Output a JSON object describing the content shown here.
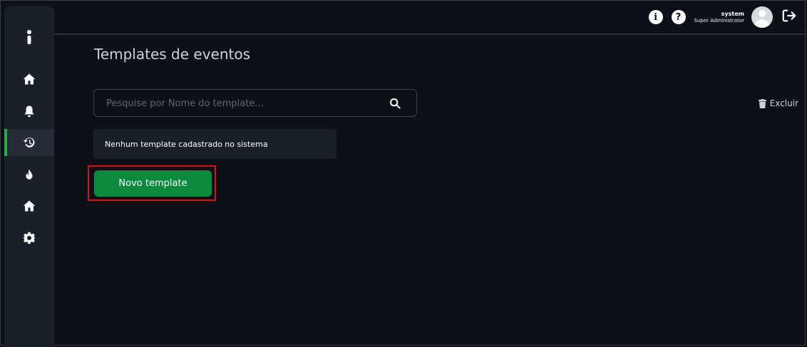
{
  "header": {
    "user_name": "system",
    "user_role": "Super Administrator",
    "info_icon": "info-icon",
    "help_icon": "help-icon",
    "logout_icon": "logout-icon"
  },
  "sidebar": {
    "items": [
      {
        "icon": "menu-dots-icon"
      },
      {
        "icon": "home-icon"
      },
      {
        "icon": "bell-icon"
      },
      {
        "icon": "history-icon",
        "active": true
      },
      {
        "icon": "fire-icon"
      },
      {
        "icon": "home-icon"
      },
      {
        "icon": "gear-icon"
      }
    ]
  },
  "main": {
    "title": "Templates de eventos",
    "search_placeholder": "Pesquise por Nome do template...",
    "delete_label": "Excluir",
    "empty_message": "Nenhum template cadastrado no sistema",
    "new_button_label": "Novo template"
  },
  "colors": {
    "background": "#0d1117",
    "sidebar": "#1a2028",
    "accent_green": "#0b8a3e",
    "active_indicator": "#2fa84f",
    "highlight_red": "#d0151c"
  }
}
